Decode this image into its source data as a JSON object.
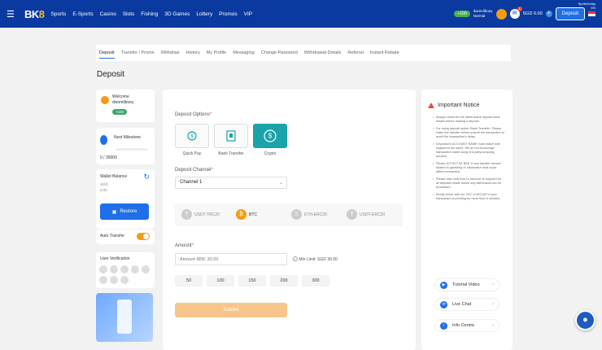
{
  "header": {
    "logo": "BK8",
    "nav": [
      "Sports",
      "E-Sports",
      "Casino",
      "Slots",
      "Fishing",
      "3D Games",
      "Lottery",
      "Promos",
      "VIP"
    ],
    "coin_badge": "+100",
    "username": "dwomilboey",
    "tier": "Normal",
    "balance": "SGD 0.00",
    "notif_count": "1",
    "deposit_label": "Deposit",
    "util_links": [
      "Sprite/today",
      "EN"
    ],
    "hamburger_icon": "menu-icon"
  },
  "tabs": [
    "Deposit",
    "Transfer / Promo",
    "Withdraw",
    "History",
    "My Profile",
    "Messaging",
    "Change Password",
    "Withdrawal Details",
    "Referral",
    "Instant Rebate"
  ],
  "page_title": "Deposit",
  "sidebar": {
    "welcome": "Welcome",
    "user": "dwomilboey",
    "points": "+100",
    "milestone_label": "Next Milestone",
    "milestone_value": "0 / 30000",
    "milestone_progress": 0,
    "wallet_label": "Wallet Balance",
    "wallet_currency": "SGD",
    "wallet_amount": "0.00",
    "restore_label": "Restore",
    "auto_transfer_label": "Auto Transfer",
    "user_verification_label": "User Verification"
  },
  "deposit": {
    "options_label": "Deposit Options",
    "options": [
      {
        "label": "Quick Pay",
        "icon": "quickpay-icon"
      },
      {
        "label": "Bank Transfer",
        "icon": "bank-icon"
      },
      {
        "label": "Crypto",
        "icon": "crypto-icon"
      }
    ],
    "selected_option": "Crypto",
    "channel_label": "Deposit Channel",
    "channel_value": "Channel 1",
    "crypto": [
      {
        "label": "USDT-TRC20",
        "symbol": "T"
      },
      {
        "label": "BTC",
        "symbol": "₿"
      },
      {
        "label": "ETH-ERC20",
        "symbol": "Ξ"
      },
      {
        "label": "USDT-ERC20",
        "symbol": "T"
      }
    ],
    "amount_label": "Amount",
    "amount_placeholder": "Amount MIN: 30.00",
    "limit_text": "Min Limit: SGD 30.00",
    "quick_amounts": [
      "50",
      "100",
      "150",
      "200",
      "300"
    ],
    "submit_label": "Submit"
  },
  "notice": {
    "title": "Important Notice",
    "items": [
      "Always check for the latest active deposit bank details before making a deposit.",
      "For using deposit option 'Bank Transfer', Please make the transfer before submit the transaction to avoid the transaction's delay.",
      "Depositor's ACCOUNT NAME must match with registered full name. We do not encourage transaction made using 3rd party/company account.",
      "Please DO NOT fill 'BK8' in any transfer remark related to gambling or information that could affect transaction.",
      "Please take note that 1x turnover is required for all deposits made before any withdrawal can be processed.",
      "Kindly check with our 24/7 LIVECHAT if your transaction is pending for more than 5 minutes."
    ],
    "help_links": [
      {
        "label": "Tutorial Video",
        "icon": "video-icon"
      },
      {
        "label": "Live Chat",
        "icon": "chat-icon"
      },
      {
        "label": "Info Centre",
        "icon": "info-icon"
      }
    ]
  },
  "colors": {
    "brand": "#0a3aa0",
    "accent": "#1e6fe8",
    "selected_option": "#1aa3a8",
    "submit_disabled": "#f7c58b"
  }
}
